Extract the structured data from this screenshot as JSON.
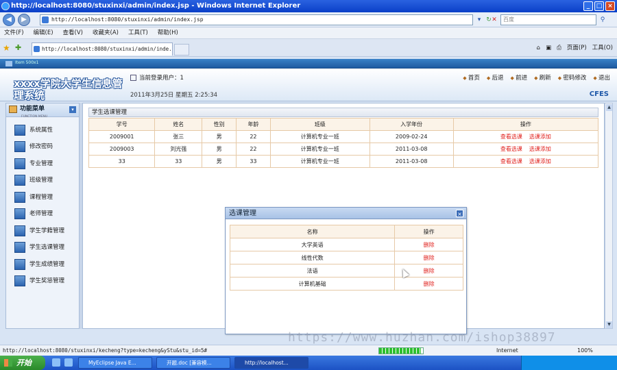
{
  "browser": {
    "title": "http://localhost:8080/stuxinxi/admin/index.jsp - Windows Internet Explorer",
    "address": "http://localhost:8080/stuxinxi/admin/index.jsp",
    "search_placeholder": "百度",
    "tab_label": "http://localhost:8080/stuxinxi/admin/inde...",
    "menu": [
      "文件(F)",
      "编辑(E)",
      "查看(V)",
      "收藏夹(A)",
      "工具(T)",
      "帮助(H)"
    ],
    "toolbar_right": [
      "页面(P)",
      "工具(O)"
    ],
    "status_url": "http://localhost:8080/stuxinxi/kecheng?type=kecheng&yStu&stu_id=5#",
    "progress": 0.95,
    "zone": "Internet",
    "zoom": "100%",
    "header_label": "Item 500x1"
  },
  "header": {
    "logo": "xxxx学院大学生信息管理系统",
    "user_label": "当前登录用户：1",
    "datetime": "2011年3月25日 星期五 2:25:34",
    "nav": [
      "首页",
      "后退",
      "前进",
      "刷新",
      "密码修改",
      "退出"
    ],
    "brand": "CFES"
  },
  "sidebar": {
    "title": "功能菜单",
    "subtitle": "FUNCTION MENU",
    "items": [
      "系统属性",
      "修改密码",
      "专业管理",
      "班级管理",
      "课程管理",
      "老师管理",
      "学生学籍管理",
      "学生选课管理",
      "学生成绩管理",
      "学生奖惩管理"
    ]
  },
  "main": {
    "title": "学生选课管理",
    "columns": [
      "学号",
      "姓名",
      "性别",
      "年龄",
      "班级",
      "入学年份",
      "操作"
    ],
    "rows": [
      {
        "id": "2009001",
        "name": "张三",
        "gender": "男",
        "age": "22",
        "class": "计算机专业一班",
        "year": "2009-02-24"
      },
      {
        "id": "2009003",
        "name": "刘光强",
        "gender": "男",
        "age": "22",
        "class": "计算机专业一班",
        "year": "2011-03-08"
      },
      {
        "id": "33",
        "name": "33",
        "gender": "男",
        "age": "33",
        "class": "计算机专业一班",
        "year": "2011-03-08"
      }
    ],
    "action_view": "查看选课",
    "action_add": "选课添加"
  },
  "dialog": {
    "title": "选课管理",
    "columns": [
      "名称",
      "操作"
    ],
    "rows": [
      "大学英语",
      "线性代数",
      "法语",
      "计算机基础"
    ],
    "delete_label": "删除"
  },
  "watermark": "https://www.huzhan.com/ishop38897",
  "taskbar": {
    "start": "开始",
    "buttons": [
      "MyEclipse Java E...",
      "开题.doc [兼容模...",
      "http://localhost..."
    ]
  }
}
